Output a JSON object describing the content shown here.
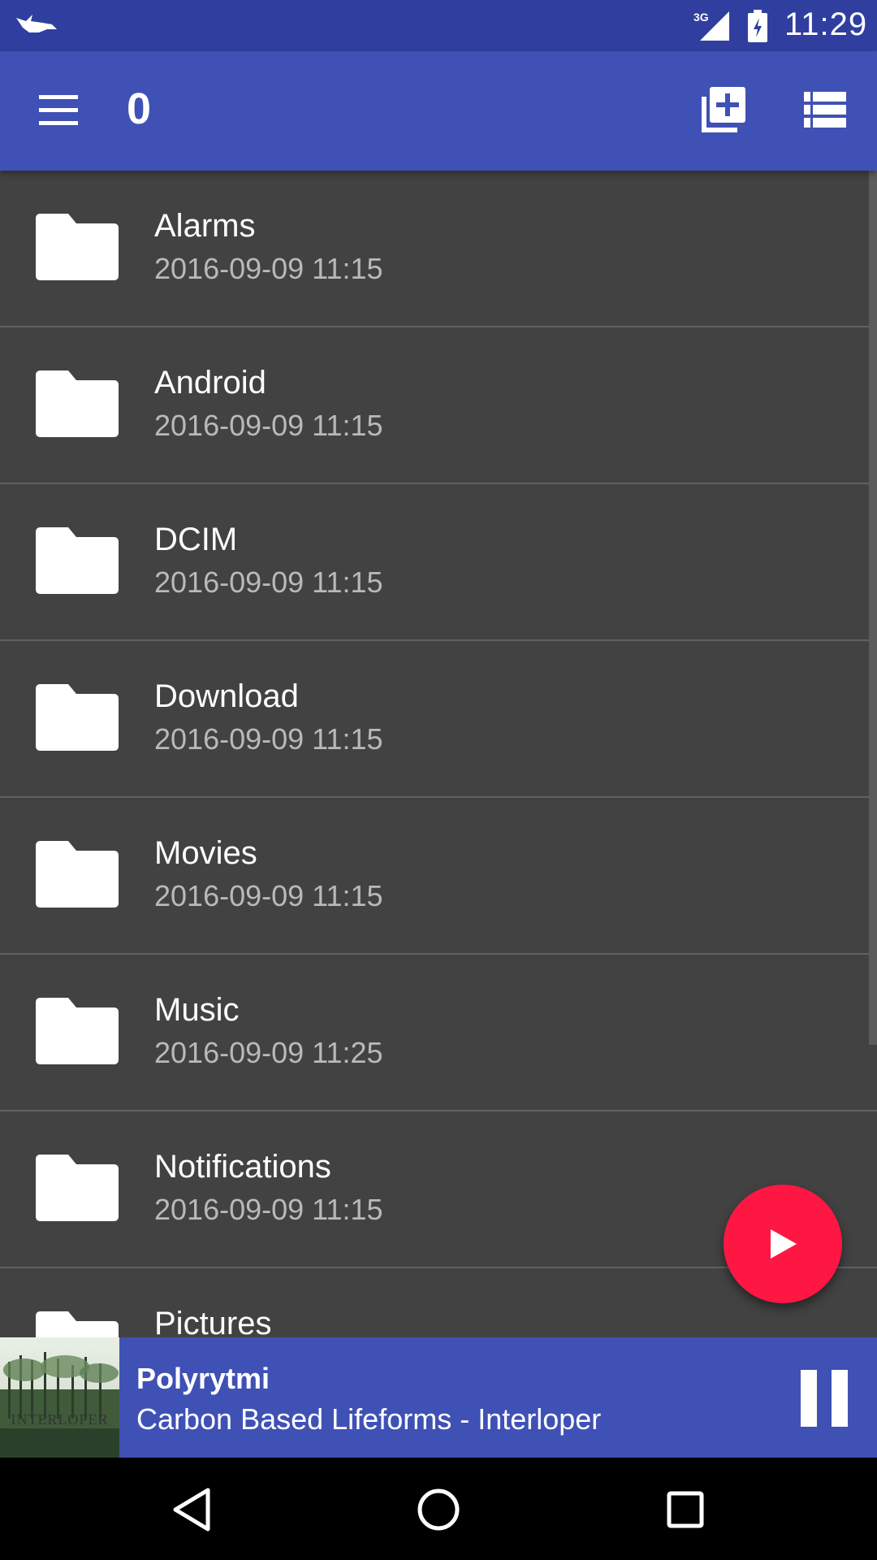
{
  "status_bar": {
    "time": "11:29",
    "network": "3G",
    "icons": [
      "notification-bird-icon",
      "signal-icon",
      "battery-icon"
    ]
  },
  "app_bar": {
    "title": "0",
    "icons": [
      "menu-icon",
      "add-library-icon",
      "view-list-icon"
    ]
  },
  "files": [
    {
      "name": "Alarms",
      "date": "2016-09-09 11:15"
    },
    {
      "name": "Android",
      "date": "2016-09-09 11:15"
    },
    {
      "name": "DCIM",
      "date": "2016-09-09 11:15"
    },
    {
      "name": "Download",
      "date": "2016-09-09 11:15"
    },
    {
      "name": "Movies",
      "date": "2016-09-09 11:15"
    },
    {
      "name": "Music",
      "date": "2016-09-09 11:25"
    },
    {
      "name": "Notifications",
      "date": "2016-09-09 11:15"
    },
    {
      "name": "Pictures",
      "date": ""
    }
  ],
  "fab": {
    "icon": "play-icon"
  },
  "now_playing": {
    "title": "Polyrytmi",
    "artist": "Carbon Based Lifeforms - Interloper",
    "album_art_text": "INTERLOPER",
    "control_icon": "pause-icon"
  },
  "colors": {
    "primary": "#3f51b5",
    "primary_dark": "#303f9f",
    "accent": "#ff1744",
    "background": "#424242"
  }
}
